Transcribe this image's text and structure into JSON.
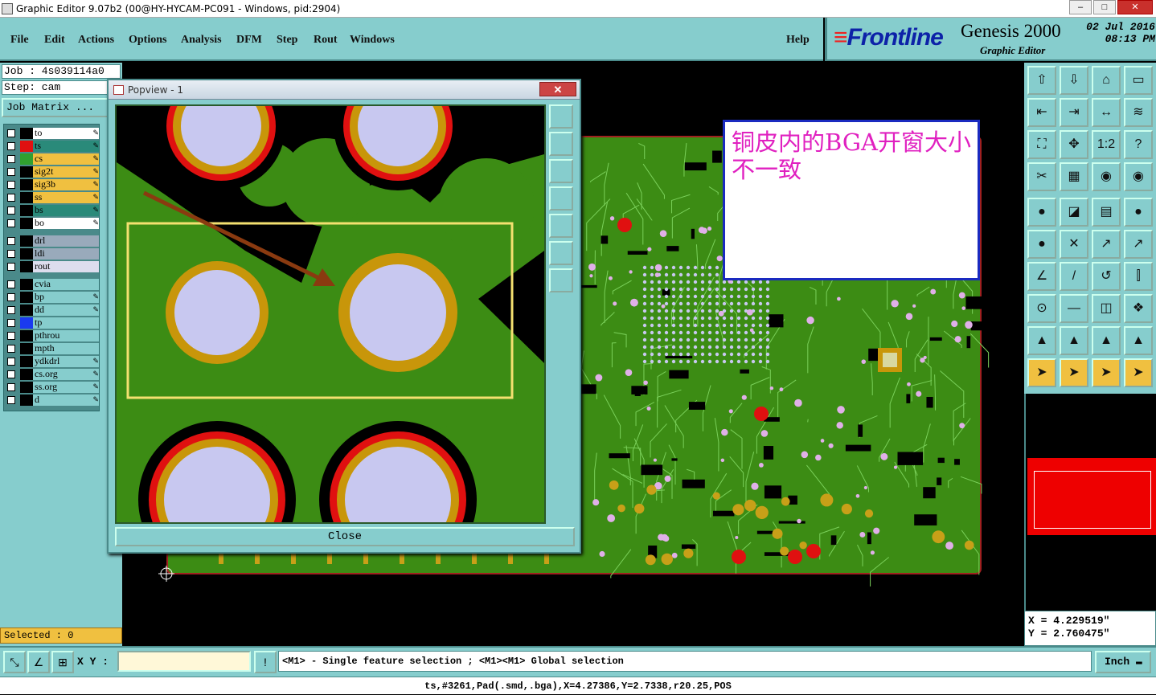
{
  "window": {
    "title": "Graphic Editor 9.07b2 (00@HY-HYCAM-PC091 - Windows, pid:2904)",
    "controls": [
      "–",
      "□",
      "✕"
    ]
  },
  "menu": {
    "items": [
      "File",
      "Edit",
      "Actions",
      "Options",
      "Analysis",
      "DFM",
      "Step",
      "Rout",
      "Windows"
    ],
    "help": "Help"
  },
  "brand": {
    "logo": "Frontline",
    "product": "Genesis 2000",
    "subtitle": "Graphic Editor",
    "date": "02 Jul 2016",
    "time": "08:13 PM"
  },
  "job": {
    "job_line": "Job : 4s039114a0",
    "step_line": "Step: cam",
    "matrix_button": "Job Matrix ..."
  },
  "layers": [
    {
      "name": "to",
      "color": "#ffffff",
      "swatch": "#000000"
    },
    {
      "name": "ts",
      "color": "#2a8a7a",
      "swatch": "#e01010",
      "active": true
    },
    {
      "name": "cs",
      "color": "#f0c040",
      "swatch": "#30a030"
    },
    {
      "name": "sig2t",
      "color": "#f0c040",
      "swatch": "#000000"
    },
    {
      "name": "sig3b",
      "color": "#f0c040",
      "swatch": "#000000"
    },
    {
      "name": "ss",
      "color": "#f0c040",
      "swatch": "#000000"
    },
    {
      "name": "bs",
      "color": "#2a8a7a",
      "swatch": "#000000"
    },
    {
      "name": "bo",
      "color": "#ffffff",
      "swatch": "#000000"
    },
    {
      "name": "drl",
      "color": "#9ab",
      "swatch": "#000000"
    },
    {
      "name": "ldi",
      "color": "#9ab",
      "swatch": "#000000"
    },
    {
      "name": "rout",
      "color": "#dde",
      "swatch": "#000000"
    },
    {
      "name": "cvia",
      "color": "#86cdcd",
      "swatch": "#000000"
    },
    {
      "name": "bp",
      "color": "#86cdcd",
      "swatch": "#000000"
    },
    {
      "name": "dd",
      "color": "#86cdcd",
      "swatch": "#000000"
    },
    {
      "name": "tp",
      "color": "#86cdcd",
      "swatch": "#1a3af0"
    },
    {
      "name": "pthrou",
      "color": "#86cdcd",
      "swatch": "#000000"
    },
    {
      "name": "mpth",
      "color": "#86cdcd",
      "swatch": "#000000"
    },
    {
      "name": "ydkdrl",
      "color": "#86cdcd",
      "swatch": "#000000"
    },
    {
      "name": "cs.org",
      "color": "#86cdcd",
      "swatch": "#000000"
    },
    {
      "name": "ss.org",
      "color": "#86cdcd",
      "swatch": "#000000"
    },
    {
      "name": "d",
      "color": "#86cdcd",
      "swatch": "#000000"
    }
  ],
  "selected": "Selected : 0",
  "popup": {
    "title": "Popview - 1",
    "close_label": "Close"
  },
  "annotation": "铜皮内的BGA开窗大小不一致",
  "coords": {
    "x": "X = 4.229519\"",
    "y": "Y = 2.760475\""
  },
  "bottom": {
    "xy_label": "X Y :",
    "xy_value": "",
    "message": "<M1> - Single feature selection ; <M1><M1> Global selection",
    "unit": "Inch"
  },
  "status": "ts,#3261,Pad(.smd,.bga),X=4.27386,Y=2.7338,r20.25,POS",
  "colors": {
    "panel": "#86cdcd",
    "copper": "#3c8c14",
    "pad": "#c8c8f0",
    "ring": "#c8960a",
    "mask": "#e01010"
  }
}
